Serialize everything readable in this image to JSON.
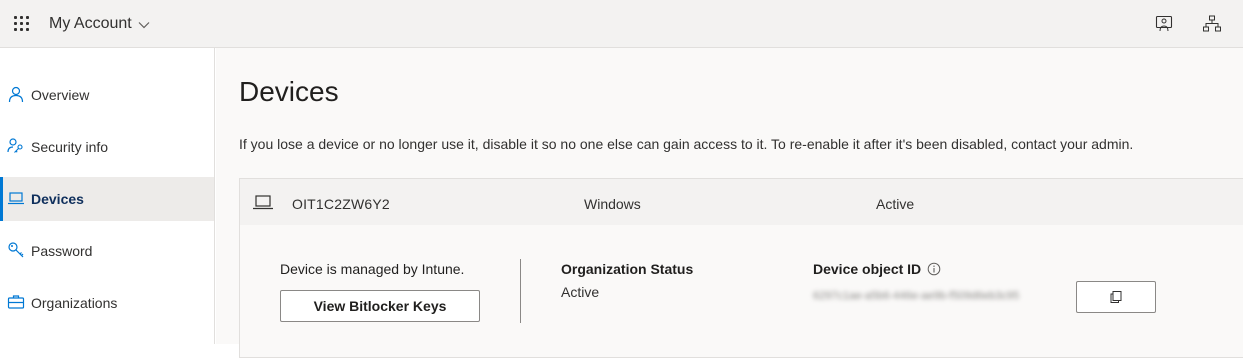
{
  "header": {
    "app_title": "My Account",
    "waffle_icon": "app-launcher-icon",
    "title_chevron_icon": "chevron-down-icon",
    "feedback_icon": "feedback-icon",
    "org_chart_icon": "org-chart-icon"
  },
  "sidebar": {
    "items": [
      {
        "label": "Overview",
        "icon": "person-icon",
        "active": false
      },
      {
        "label": "Security info",
        "icon": "security-key-icon",
        "active": false
      },
      {
        "label": "Devices",
        "icon": "laptop-icon",
        "active": true
      },
      {
        "label": "Password",
        "icon": "key-icon",
        "active": false
      },
      {
        "label": "Organizations",
        "icon": "briefcase-icon",
        "active": false
      }
    ]
  },
  "main": {
    "title": "Devices",
    "description": "If you lose a device or no longer use it, disable it so no one else can gain access to it. To re-enable it after it's been disabled, contact your admin.",
    "device": {
      "name": "OIT1C2ZW6Y2",
      "os": "Windows",
      "status": "Active",
      "managed_text": "Device is managed by Intune.",
      "bitlocker_button": "View Bitlocker Keys",
      "org_status_label": "Organization Status",
      "org_status_value": "Active",
      "object_id_label": "Device object ID",
      "object_id_value": "6297c1ae-a5b6-446e-ae9b-f509d6eb3c95",
      "copy_icon": "copy-icon",
      "info_icon": "info-icon"
    }
  },
  "colors": {
    "accent": "#0078d4",
    "topbar_bg": "#f3f2f1",
    "active_nav_bg": "#edebe9"
  }
}
